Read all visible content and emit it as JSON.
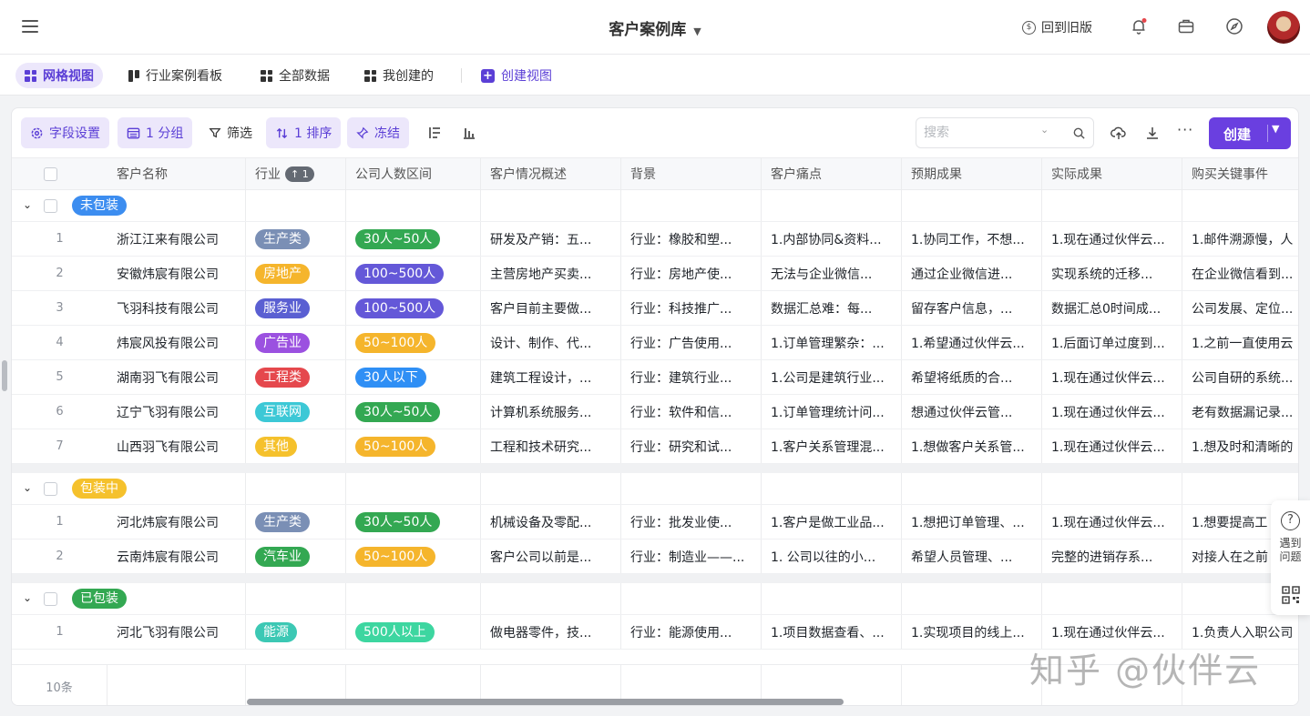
{
  "header": {
    "title": "客户案例库",
    "back_old_label": "回到旧版",
    "back_old_icon": "coin-icon"
  },
  "views": {
    "tabs": [
      {
        "label": "网格视图",
        "icon": "grid-icon",
        "active": true
      },
      {
        "label": "行业案例看板",
        "icon": "kanban-icon"
      },
      {
        "label": "全部数据",
        "icon": "grid-icon"
      },
      {
        "label": "我创建的",
        "icon": "list-icon"
      }
    ],
    "create_label": "创建视图"
  },
  "toolbar": {
    "field_settings": "字段设置",
    "group": "1 分组",
    "filter": "筛选",
    "sort": "1 排序",
    "freeze": "冻结",
    "search_placeholder": "搜索",
    "create_label": "创建"
  },
  "columns": [
    "客户名称",
    "行业",
    "公司人数区间",
    "客户情况概述",
    "背景",
    "客户痛点",
    "预期成果",
    "实际成果",
    "购买关键事件"
  ],
  "sort_badge": "↑ 1",
  "groups": [
    {
      "label": "未包装",
      "color": "#3c8df0",
      "rows": [
        {
          "num": "1",
          "name": "浙江江来有限公司",
          "industry": "生产类",
          "industry_color": "#7a8fb5",
          "size": "30人~50人",
          "size_color": "#33a852",
          "overview": "研发及产销：五...",
          "background": "行业：橡胶和塑...",
          "pain": "1.内部协同&资料...",
          "expected": "1.协同工作，不想...",
          "actual": "1.现在通过伙伴云...",
          "event": "1.邮件溯源慢，人"
        },
        {
          "num": "2",
          "name": "安徽炜宸有限公司",
          "industry": "房地产",
          "industry_color": "#f5b52c",
          "size": "100~500人",
          "size_color": "#6458d8",
          "overview": "主营房地产买卖...",
          "background": "行业：房地产使...",
          "pain": "无法与企业微信...",
          "expected": "通过企业微信进...",
          "actual": "实现系统的迁移...",
          "event": "在企业微信看到..."
        },
        {
          "num": "3",
          "name": "飞羽科技有限公司",
          "industry": "服务业",
          "industry_color": "#5a5fd2",
          "size": "100~500人",
          "size_color": "#6458d8",
          "overview": "客户目前主要做...",
          "background": "行业：科技推广...",
          "pain": "数据汇总难：每...",
          "expected": "留存客户信息，...",
          "actual": "数据汇总0时间成...",
          "event": "公司发展、定位..."
        },
        {
          "num": "4",
          "name": "炜宸风投有限公司",
          "industry": "广告业",
          "industry_color": "#9b51e0",
          "size": "50~100人",
          "size_color": "#f5b52c",
          "overview": "设计、制作、代...",
          "background": "行业：广告使用...",
          "pain": "1.订单管理繁杂：...",
          "expected": "1.希望通过伙伴云...",
          "actual": "1.后面订单过度到...",
          "event": "1.之前一直使用云"
        },
        {
          "num": "5",
          "name": "湖南羽飞有限公司",
          "industry": "工程类",
          "industry_color": "#e5484d",
          "size": "30人以下",
          "size_color": "#2f8ff5",
          "overview": "建筑工程设计，...",
          "background": "行业：建筑行业...",
          "pain": "1.公司是建筑行业...",
          "expected": "希望将纸质的合...",
          "actual": "1.现在通过伙伴云...",
          "event": "公司自研的系统..."
        },
        {
          "num": "6",
          "name": "辽宁飞羽有限公司",
          "industry": "互联网",
          "industry_color": "#3cc8d6",
          "size": "30人~50人",
          "size_color": "#33a852",
          "overview": "计算机系统服务...",
          "background": "行业：软件和信...",
          "pain": "1.订单管理统计问...",
          "expected": "想通过伙伴云管...",
          "actual": "1.现在通过伙伴云...",
          "event": "老有数据漏记录..."
        },
        {
          "num": "7",
          "name": "山西羽飞有限公司",
          "industry": "其他",
          "industry_color": "#f5c12c",
          "size": "50~100人",
          "size_color": "#f5b52c",
          "overview": "工程和技术研究...",
          "background": "行业：研究和试...",
          "pain": "1.客户关系管理混...",
          "expected": "1.想做客户关系管...",
          "actual": "1.现在通过伙伴云...",
          "event": "1.想及时和清晰的"
        }
      ]
    },
    {
      "label": "包装中",
      "color": "#f5c12c",
      "rows": [
        {
          "num": "1",
          "name": "河北炜宸有限公司",
          "industry": "生产类",
          "industry_color": "#7a8fb5",
          "size": "30人~50人",
          "size_color": "#33a852",
          "overview": "机械设备及零配...",
          "background": "行业：批发业使...",
          "pain": "1.客户是做工业品...",
          "expected": "1.想把订单管理、...",
          "actual": "1.现在通过伙伴云...",
          "event": "1.想要提高工"
        },
        {
          "num": "2",
          "name": "云南炜宸有限公司",
          "industry": "汽车业",
          "industry_color": "#33a852",
          "size": "50~100人",
          "size_color": "#f5b52c",
          "overview": "客户公司以前是...",
          "background": "行业：制造业——...",
          "pain": "1. 公司以往的小...",
          "expected": "希望人员管理、...",
          "actual": "完整的进销存系...",
          "event": "对接人在之前"
        }
      ]
    },
    {
      "label": "已包装",
      "color": "#33a852",
      "rows": [
        {
          "num": "1",
          "name": "河北飞羽有限公司",
          "industry": "能源",
          "industry_color": "#3cc8b4",
          "size": "500人以上",
          "size_color": "#3dd6a0",
          "overview": "做电器零件，技...",
          "background": "行业：能源使用...",
          "pain": "1.项目数据查看、...",
          "expected": "1.实现项目的线上...",
          "actual": "1.现在通过伙伴云...",
          "event": "1.负责人入职公司"
        }
      ]
    }
  ],
  "footer": {
    "count": "10条"
  },
  "watermark": "知乎 @伙伴云",
  "help": {
    "line1": "遇到",
    "line2": "问题"
  },
  "colors": {
    "accent": "#6a3fe0",
    "accent_light": "#ece7fb"
  }
}
